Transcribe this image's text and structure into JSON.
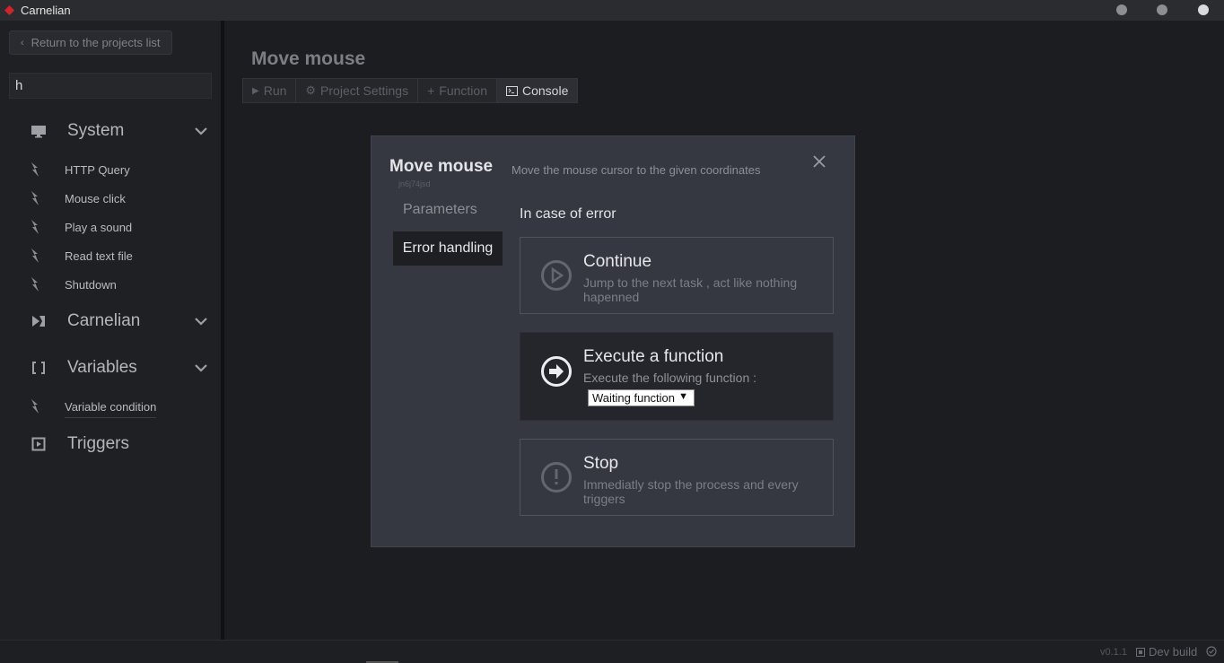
{
  "app": {
    "title": "Carnelian",
    "accent": "#d2222a"
  },
  "sidebar": {
    "back_label": "Return to the projects list",
    "search_value": "h",
    "categories": [
      {
        "label": "System",
        "icon": "monitor-icon",
        "items": [
          "HTTP Query",
          "Mouse click",
          "Play a sound",
          "Read text file",
          "Shutdown"
        ]
      },
      {
        "label": "Carnelian",
        "icon": "carnelian-icon",
        "items": []
      },
      {
        "label": "Variables",
        "icon": "brackets-icon",
        "items": [
          "Variable condition"
        ]
      },
      {
        "label": "Triggers",
        "icon": "trigger-icon",
        "items": []
      }
    ]
  },
  "main": {
    "title": "Move mouse",
    "toolbar": {
      "run": "Run",
      "settings": "Project Settings",
      "function": "Function",
      "console": "Console"
    }
  },
  "modal": {
    "title": "Move mouse",
    "id": "jn6j74jsd",
    "description": "Move the mouse cursor to the given coordinates",
    "tabs": {
      "parameters": "Parameters",
      "error_handling": "Error handling"
    },
    "section_title": "In case of error",
    "options": [
      {
        "title": "Continue",
        "desc": "Jump to the next task , act like nothing hapenned",
        "icon": "play-circle-icon",
        "selected": false
      },
      {
        "title": "Execute a function",
        "desc": "Execute the following function :",
        "icon": "arrow-right-circle-icon",
        "selected": true,
        "select_value": "Waiting function"
      },
      {
        "title": "Stop",
        "desc": "Immediatly stop the process and every triggers",
        "icon": "exclamation-circle-icon",
        "selected": false
      }
    ]
  },
  "status": {
    "version": "v0.1.1",
    "build": "Dev build"
  }
}
